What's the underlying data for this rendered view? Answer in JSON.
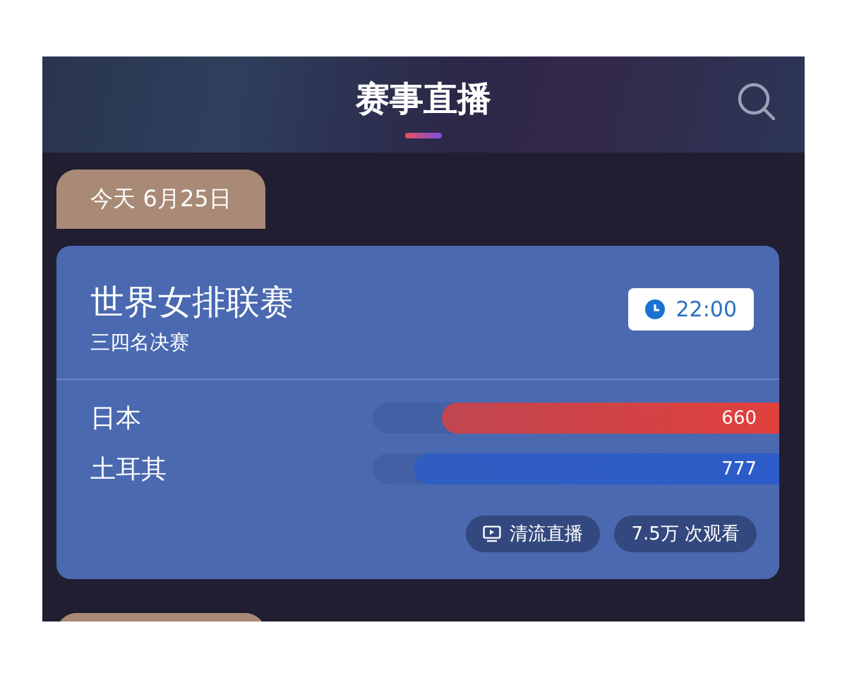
{
  "header": {
    "title": "赛事直播"
  },
  "date_tab": {
    "label": "今天 6月25日"
  },
  "match": {
    "title": "世界女排联赛",
    "stage": "三四名决赛",
    "time": "22:00",
    "teams": [
      {
        "name": "日本",
        "votes": "660",
        "level": 0.83,
        "color": "#e0403c"
      },
      {
        "name": "土耳其",
        "votes": "777",
        "level": 0.9,
        "color": "#2c5cc8"
      }
    ],
    "stream_button": "清流直播",
    "views": "7.5万 次观看"
  },
  "next_date_tab": {
    "kind": "tab"
  }
}
